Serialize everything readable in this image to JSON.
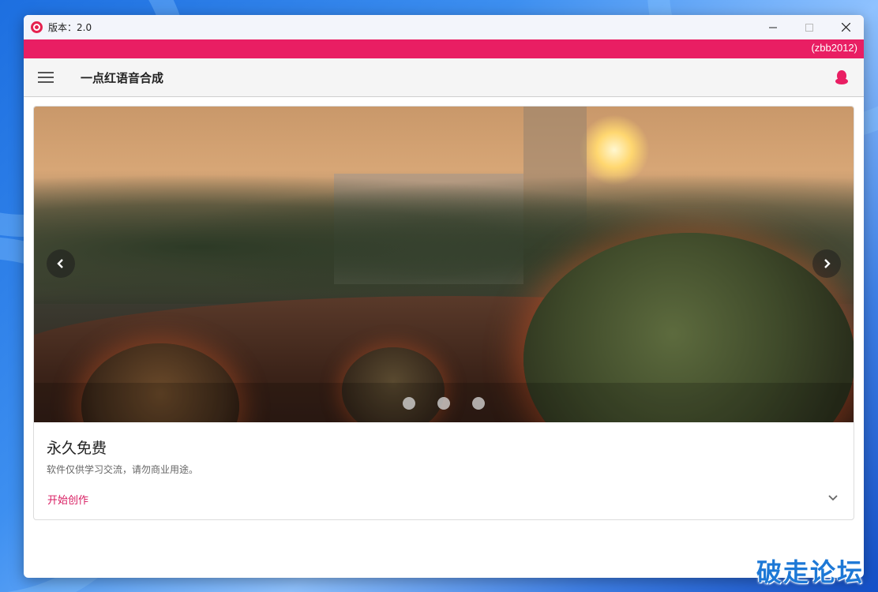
{
  "window": {
    "title": "版本：2.0",
    "controls": {
      "minimize": "—",
      "maximize": "☐",
      "close": "✕"
    }
  },
  "banner": {
    "user_tag": "(zbb2012)"
  },
  "toolbar": {
    "menu_icon": "hamburger-menu-icon",
    "app_title": "一点红语音合成",
    "right_icon": "qq-penguin-icon"
  },
  "carousel": {
    "prev_icon": "chevron-left-icon",
    "next_icon": "chevron-right-icon",
    "slide_count": 3
  },
  "card": {
    "title": "永久免费",
    "subtitle": "软件仅供学习交流，请勿商业用途。",
    "action_label": "开始创作",
    "expand_icon": "chevron-down-icon"
  },
  "watermark": {
    "text": "破走论坛"
  },
  "colors": {
    "accent": "#e91e63",
    "action_text": "#d81b60",
    "toolbar_bg": "#f5f5f5"
  }
}
